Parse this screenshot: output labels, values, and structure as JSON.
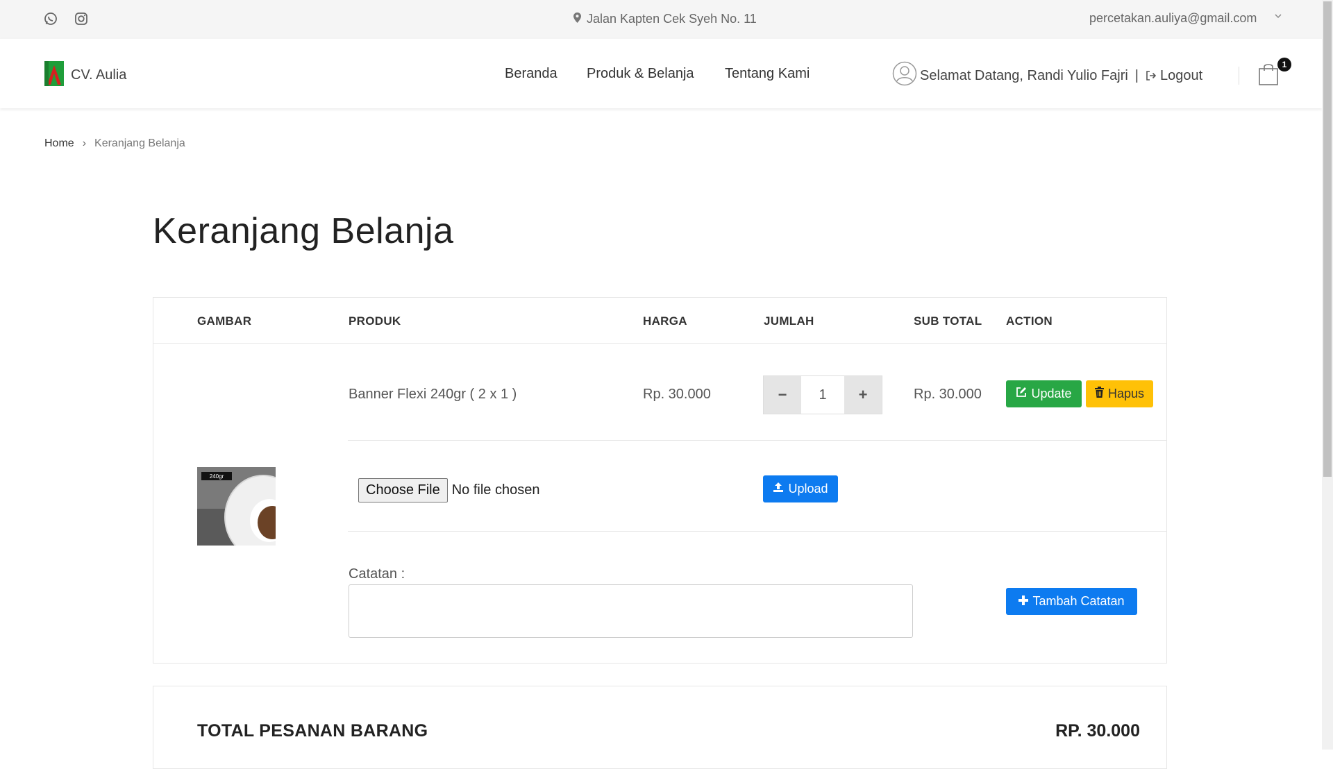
{
  "topbar": {
    "address": "Jalan Kapten Cek Syeh No. 11",
    "email": "percetakan.auliya@gmail.com",
    "icons": [
      "whatsapp-icon",
      "instagram-icon",
      "map-marker-icon",
      "chevron-down-icon"
    ]
  },
  "header": {
    "brand": "CV. Aulia",
    "nav": [
      "Beranda",
      "Produk & Belanja",
      "Tentang Kami"
    ],
    "welcome": "Selamat Datang, Randi Yulio Fajri",
    "separator": "|",
    "logout": "Logout",
    "cart_count": "1"
  },
  "breadcrumb": {
    "home": "Home",
    "separator": "›",
    "current": "Keranjang Belanja"
  },
  "page_title": "Keranjang Belanja",
  "cart": {
    "columns": [
      "GAMBAR",
      "PRODUK",
      "HARGA",
      "JUMLAH",
      "SUB TOTAL",
      "ACTION"
    ],
    "item": {
      "product": "Banner Flexi 240gr ( 2 x 1 )",
      "price": "Rp. 30.000",
      "quantity": "1",
      "minus": "−",
      "plus": "+",
      "subtotal": "Rp. 30.000",
      "update_label": "Update",
      "delete_label": "Hapus",
      "image_label": "240gr"
    },
    "file": {
      "choose_label": "Choose File",
      "status": "No file chosen",
      "upload_label": "Upload"
    },
    "note": {
      "label": "Catatan :",
      "value": "",
      "add_label": "Tambah Catatan"
    }
  },
  "total": {
    "label": "TOTAL PESANAN BARANG",
    "amount": "RP. 30.000"
  },
  "colors": {
    "update": "#28a745",
    "delete": "#ffc107",
    "primary": "#0d7bf0",
    "topbar": "#f5f5f5"
  }
}
